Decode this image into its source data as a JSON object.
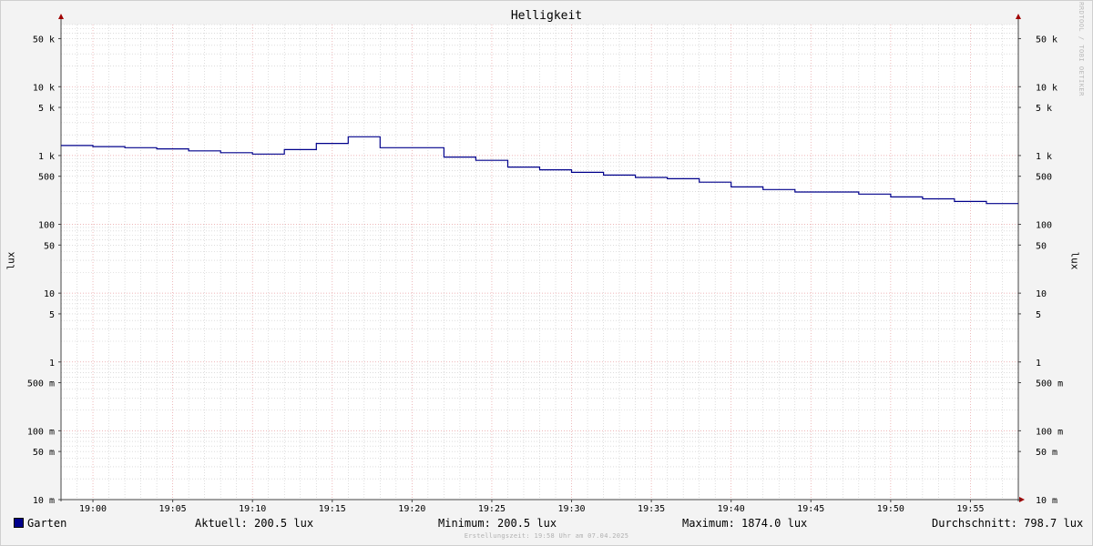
{
  "chart_data": {
    "type": "line",
    "title": "Helligkeit",
    "ylabel": "lux",
    "y_scale": "log",
    "ylim": [
      0.01,
      80000
    ],
    "y_ticks": [
      {
        "value": 50000,
        "label": "50 k"
      },
      {
        "value": 10000,
        "label": "10 k"
      },
      {
        "value": 5000,
        "label": "5 k"
      },
      {
        "value": 1000,
        "label": "1 k"
      },
      {
        "value": 500,
        "label": "500"
      },
      {
        "value": 100,
        "label": "100"
      },
      {
        "value": 50,
        "label": "50"
      },
      {
        "value": 10,
        "label": "10"
      },
      {
        "value": 5,
        "label": "5"
      },
      {
        "value": 1,
        "label": "1"
      },
      {
        "value": 0.5,
        "label": "500 m"
      },
      {
        "value": 0.1,
        "label": "100 m"
      },
      {
        "value": 0.05,
        "label": "50 m"
      },
      {
        "value": 0.01,
        "label": "10 m"
      }
    ],
    "xlim": [
      "18:58",
      "19:58"
    ],
    "x_ticks": [
      "19:00",
      "19:05",
      "19:10",
      "19:15",
      "19:20",
      "19:25",
      "19:30",
      "19:35",
      "19:40",
      "19:45",
      "19:50",
      "19:55"
    ],
    "grid": true,
    "series": [
      {
        "name": "Garten",
        "color": "#00008b",
        "step": true,
        "x": [
          "18:58",
          "19:00",
          "19:02",
          "19:04",
          "19:06",
          "19:08",
          "19:10",
          "19:12",
          "19:14",
          "19:16",
          "19:18",
          "19:20",
          "19:22",
          "19:24",
          "19:26",
          "19:28",
          "19:30",
          "19:32",
          "19:34",
          "19:36",
          "19:38",
          "19:40",
          "19:42",
          "19:44",
          "19:46",
          "19:48",
          "19:50",
          "19:52",
          "19:54",
          "19:56"
        ],
        "values": [
          1400,
          1350,
          1300,
          1250,
          1170,
          1100,
          1050,
          1220,
          1500,
          1874,
          1300,
          1300,
          950,
          850,
          680,
          620,
          570,
          520,
          480,
          460,
          410,
          350,
          320,
          295,
          295,
          275,
          250,
          235,
          215,
          200.5
        ]
      }
    ],
    "stats": {
      "current": "Aktuell: 200.5 lux",
      "minimum": "Minimum: 200.5 lux",
      "maximum": "Maximum: 1874.0 lux",
      "average": "Durchschnitt: 798.7 lux"
    }
  },
  "legend": {
    "series_label": "Garten",
    "series_color": "#00008b"
  },
  "watermark": "RRDTOOL / TOBI OETIKER",
  "footer": "Erstellungszeit: 19:58 Uhr am 07.04.2025",
  "colors": {
    "background": "#f3f3f3",
    "plot_area": "#ffffff",
    "major_grid": "#e89ea0",
    "minor_grid": "#c8c8c8",
    "axis": "#444444",
    "arrow": "#a00000"
  }
}
